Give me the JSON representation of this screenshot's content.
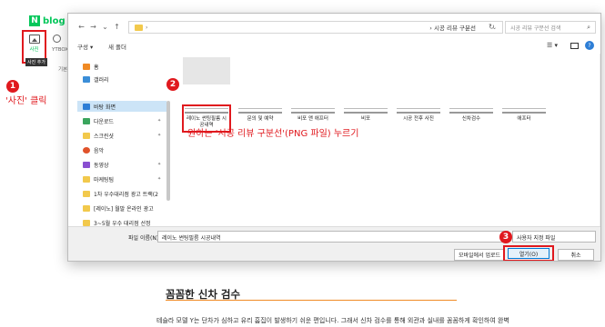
{
  "blog": {
    "logo_n": "N",
    "logo_text": "blog",
    "photo_label": "사진",
    "photo_tooltip": "사진 추가",
    "ytbox_label": "YTBOX",
    "side_trunc": "기본",
    "article_title": "꼼꼼한 신차 검수",
    "article_body": "테슬라 모델 Y는 단차가 심하고 유리 흠집이 발생하기 쉬운 편입니다. 그래서 신차 검수를 통해 외관과 실내를 꼼꼼하게 확인하여 완벽"
  },
  "annotations": {
    "step1_marker": "1",
    "step1_text": "'사진' 클릭",
    "step2_marker": "2",
    "step2_text": "원하는 '시공 리뷰 구분선'(PNG 파일) 누르기",
    "step3_marker": "3"
  },
  "dialog": {
    "nav": {
      "back": "←",
      "forward": "→",
      "down": "⌄",
      "up": "↑",
      "path": "› 시공 리뷰 구분선",
      "refresh": "↻"
    },
    "search_placeholder": "시공 리뷰 구분선 검색",
    "toolbar": {
      "organize": "구성 ▾",
      "new_folder": "새 폴더",
      "view": "☰ ▾",
      "help": "?"
    },
    "sidebar": [
      {
        "label": "홈",
        "icon": "home-icon"
      },
      {
        "label": "갤러리",
        "icon": "gallery-icon"
      },
      {
        "label": "바탕 화면",
        "icon": "desktop-icon",
        "selected": true
      },
      {
        "label": "다운로드",
        "icon": "download-icon"
      },
      {
        "label": "스크린샷",
        "icon": "folder-icon"
      },
      {
        "label": "음악",
        "icon": "music-icon"
      },
      {
        "label": "동영상",
        "icon": "video-icon"
      },
      {
        "label": "마케팅팀",
        "icon": "folder-icon"
      },
      {
        "label": "1차 우수대리점 광고 트랙(2",
        "icon": "folder-icon"
      },
      {
        "label": "[레이노] 월말 온라인 광고",
        "icon": "folder-icon"
      },
      {
        "label": "3~5월 우수 대리점 선정",
        "icon": "folder-icon"
      }
    ],
    "files": [
      {
        "name": "레이노 썬팅필름 시공내역",
        "selected": true
      },
      {
        "name": "문의 및 예약"
      },
      {
        "name": "비포 앤 애프터"
      },
      {
        "name": "비포"
      },
      {
        "name": "시공 전후 사진"
      },
      {
        "name": "신차검수"
      },
      {
        "name": "애프터"
      }
    ],
    "filename_label": "파일 이름(N):",
    "filename_value": "레이노 썬팅필름 시공내역",
    "filetype_value": "사용자 지정 파일",
    "mobile_upload": "모바일에서 업로드",
    "open_button": "열기(O)",
    "cancel_button": "취소"
  },
  "colors": {
    "accent": "#e0191e",
    "naver_green": "#03c75a",
    "selection": "#cce4f7"
  }
}
